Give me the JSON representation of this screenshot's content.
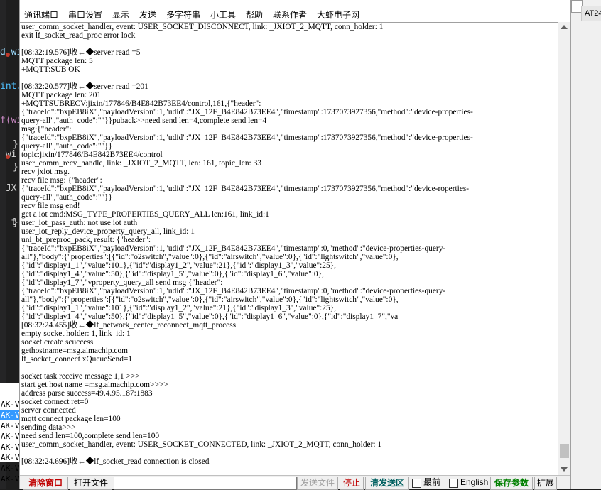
{
  "ide": {
    "code_lines": [
      "d wi",
      "int.",
      "f(wi",
      " wi",
      " JX",
      "  t"
    ],
    "ak_rows": [
      "AK-V",
      "AK-V",
      "AK-V",
      "AK-V",
      "AK-V",
      "AK-V",
      "AK-V",
      "AK-V"
    ]
  },
  "right_window": {
    "tab_label": "AT24"
  },
  "menu": [
    "通讯端口",
    "串口设置",
    "显示",
    "发送",
    "多字符串",
    "小工具",
    "帮助",
    "联系作者",
    "大虾电子网"
  ],
  "terminal_lines": [
    "user_comm_socket_handler, event: USER_SOCKET_DISCONNECT, link: _JXIOT_2_MQTT, conn_holder: 1",
    "exit lf_socket_read_proc error lock",
    "",
    "[08:32:19.576]收←◆server read =5",
    "MQTT package len: 5",
    "+MQTT:SUB OK",
    "",
    "[08:32:20.577]收←◆server read =201",
    "MQTT package len: 201",
    "+MQTTSUBRECV:jixin/177846/B4E842B73EE4/control,161,{\"header\":",
    "{\"traceId\":\"bxpEB8iX\",\"payloadVersion\":1,\"udid\":\"JX_12F_B4E842B73EE4\",\"timestamp\":1737073927356,\"method\":\"device-properties-",
    "query-all\",\"auth_code\":\"\"}}puback>>need send len=4,complete send len=4",
    "msg:{\"header\":",
    "{\"traceId\":\"bxpEB8iX\",\"payloadVersion\":1,\"udid\":\"JX_12F_B4E842B73EE4\",\"timestamp\":1737073927356,\"method\":\"device-properties-",
    "query-all\",\"auth_code\":\"\"}}",
    "topic:jixin/177846/B4E842B73EE4/control",
    "user_comm_recv_handle, link: _JXIOT_2_MQTT, len: 161, topic_len: 33",
    "recv jxiot msg.",
    "recv file msg: {\"header\":",
    "{\"traceId\":\"bxpEB8iX\",\"payloadVersion\":1,\"udid\":\"JX_12F_B4E842B73EE4\",\"timestamp\":1737073927356,\"method\":\"device-roperties-",
    "query-all\",\"auth_code\":\"\"}}",
    "recv file msg end!",
    "get a iot cmd:MSG_TYPE_PROPERTIES_QUERY_ALL len:161, link_id:1",
    "user_iot_pass_auth: not use iot auth",
    "user_iot_reply_device_property_query_all, link_id: 1",
    "uni_bt_preproc_pack, result: {\"header\":",
    "{\"traceId\":\"bxpEB8iX\",\"payloadVersion\":1,\"udid\":\"JX_12F_B4E842B73EE4\",\"timestamp\":0,\"method\":\"device-properties-query-",
    "all\"},\"body\":{\"properties\":[{\"id\":\"o2switch\",\"value\":0},{\"id\":\"airswitch\",\"value\":0},{\"id\":\"lightswitch\",\"value\":0},",
    "{\"id\":\"display1_1\",\"value\":101},{\"id\":\"display1_2\",\"value\":21},{\"id\":\"display1_3\",\"value\":25},",
    "{\"id\":\"display1_4\",\"value\":50},{\"id\":\"display1_5\",\"value\":0},{\"id\":\"display1_6\",\"value\":0},",
    "{\"id\":\"display1_7\",\"vproperty_query_all send msg {\"header\":",
    "{\"traceId\":\"bxpEB8iX\",\"payloadVersion\":1,\"udid\":\"JX_12F_B4E842B73EE4\",\"timestamp\":0,\"method\":\"device-properties-query-",
    "all\"},\"body\":{\"properties\":[{\"id\":\"o2switch\",\"value\":0},{\"id\":\"airswitch\",\"value\":0},{\"id\":\"lightswitch\",\"value\":0},",
    "{\"id\":\"display1_1\",\"value\":101},{\"id\":\"display1_2\",\"value\":21},{\"id\":\"display1_3\",\"value\":25},",
    "{\"id\":\"display1_4\",\"value\":50},{\"id\":\"display1_5\",\"value\":0},{\"id\":\"display1_6\",\"value\":0},{\"id\":\"display1_7\",\"va",
    "[08:32:24.455]收←◆lf_network_center_reconnect_mqtt_process",
    "empty socket holder: 1, link_id: 1",
    "socket create scuccess",
    "gethostname=msg.aimachip.com",
    "lf_socket_connect xQueueSend=1",
    "",
    "socket task receive message 1,1 >>>",
    "start get host name =msg.aimachip.com>>>>",
    "address parse success=49.4.95.187:1883",
    "socket connect ret=0",
    "server connected",
    "mqtt connect package len=100",
    "sending data>>>",
    "need send len=100,complete send len=100",
    "user_comm_socket_handler, event: USER_SOCKET_CONNECTED, link: _JXIOT_2_MQTT, conn_holder: 1",
    "",
    "[08:32:24.696]收←◆lf_socket_read connection is closed"
  ],
  "bottom": {
    "clear_window": "清除窗口",
    "open_file": "打开文件",
    "send_file": "发送文件",
    "stop": "停止",
    "clear_send_area": "清发送区",
    "topmost": "最前",
    "english": "English",
    "save_params": "保存参数",
    "expand": "扩展"
  }
}
